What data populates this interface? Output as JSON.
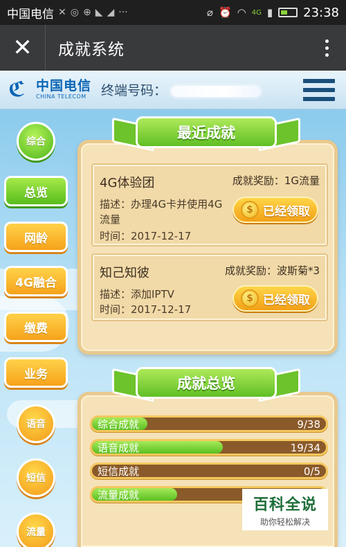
{
  "status_bar": {
    "carrier": "中国电信",
    "network": "4G",
    "time": "23:38"
  },
  "title_bar": {
    "title": "成就系统"
  },
  "brand": {
    "logo_cn": "中国电信",
    "logo_en": "CHINA TELECOM",
    "terminal_label": "终端号码："
  },
  "nav": {
    "items": [
      {
        "label": "综合",
        "shape": "circle",
        "color": "green"
      },
      {
        "label": "总览",
        "shape": "pill",
        "color": "green"
      },
      {
        "label": "网龄",
        "shape": "pill",
        "color": "orange"
      },
      {
        "label": "4G融合",
        "shape": "pill",
        "color": "orange"
      },
      {
        "label": "缴费",
        "shape": "pill",
        "color": "orange"
      },
      {
        "label": "业务",
        "shape": "pill",
        "color": "orange"
      },
      {
        "label": "语音",
        "shape": "circle",
        "color": "orange"
      },
      {
        "label": "短信",
        "shape": "circle",
        "color": "orange"
      },
      {
        "label": "流量",
        "shape": "circle",
        "color": "orange"
      }
    ]
  },
  "recent": {
    "title": "最近成就",
    "cards": [
      {
        "name": "4G体验团",
        "reward": "成就奖励：1G流量",
        "desc": "描述：办理4G卡并使用4G流量",
        "time": "时间：2017-12-17",
        "button": "已经领取"
      },
      {
        "name": "知己知彼",
        "reward": "成就奖励：波斯菊*3",
        "desc": "描述：添加IPTV",
        "time": "时间：2017-12-17",
        "button": "已经领取"
      }
    ]
  },
  "summary": {
    "title": "成就总览",
    "bars": [
      {
        "label": "综合成就",
        "done": 9,
        "total": 38,
        "count": "9/38"
      },
      {
        "label": "语音成就",
        "done": 19,
        "total": 34,
        "count": "19/34"
      },
      {
        "label": "短信成就",
        "done": 0,
        "total": 5,
        "count": "0/5"
      },
      {
        "label": "流量成就",
        "done": 12,
        "total": 33,
        "count": ""
      }
    ]
  },
  "watermark": {
    "title": "百科全说",
    "subtitle": "助你轻松解决"
  },
  "colors": {
    "status_bar": "#1f1f1f",
    "title_bar": "#393a3c",
    "brand_blue": "#0a65b4",
    "green": "#5fbf24",
    "orange": "#f6a21a",
    "panel": "#f6e2b8",
    "bar_track": "#8a5a2a"
  },
  "icons": [
    "signal-icon",
    "wechat-icon",
    "alarm-icon",
    "wifi-icon",
    "battery-icon",
    "close-icon",
    "more-icon",
    "list-icon",
    "coin-icon"
  ]
}
